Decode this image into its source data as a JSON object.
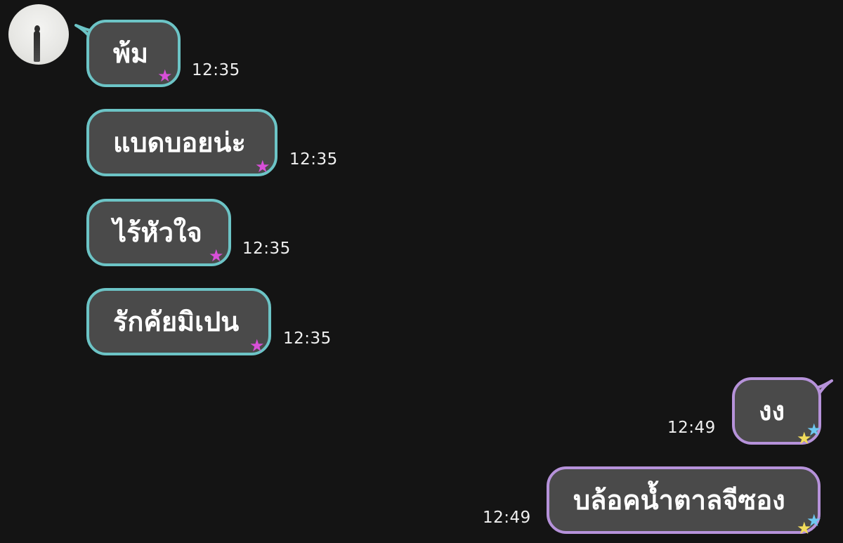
{
  "contact": {
    "avatar_icon": "person-silhouette-avatar-icon"
  },
  "messages": [
    {
      "direction": "incoming",
      "text": "พ้ม",
      "time": "12:35",
      "star_colors": [
        "#d84fd8"
      ]
    },
    {
      "direction": "incoming",
      "text": "แบดบอยน่ะ",
      "time": "12:35",
      "star_colors": [
        "#d84fd8"
      ]
    },
    {
      "direction": "incoming",
      "text": "ไร้หัวใจ",
      "time": "12:35",
      "star_colors": [
        "#d84fd8"
      ]
    },
    {
      "direction": "incoming",
      "text": "รักคัยมิเปน",
      "time": "12:35",
      "star_colors": [
        "#d84fd8"
      ]
    },
    {
      "direction": "outgoing",
      "text": "งง",
      "time": "12:49",
      "star_colors": [
        "#6ec8f0",
        "#f2dc5a"
      ]
    },
    {
      "direction": "outgoing",
      "text": "บล้อคน้ำตาลจีซอง",
      "time": "12:49",
      "star_colors": [
        "#6ec8f0",
        "#f2dc5a"
      ]
    }
  ],
  "colors": {
    "background": "#141414",
    "bubble_fill": "#4a4a4a",
    "incoming_border": "#6cc4c6",
    "outgoing_border": "#b692da",
    "incoming_star": "#d84fd8",
    "outgoing_star_blue": "#6ec8f0",
    "outgoing_star_yellow": "#f2dc5a"
  }
}
